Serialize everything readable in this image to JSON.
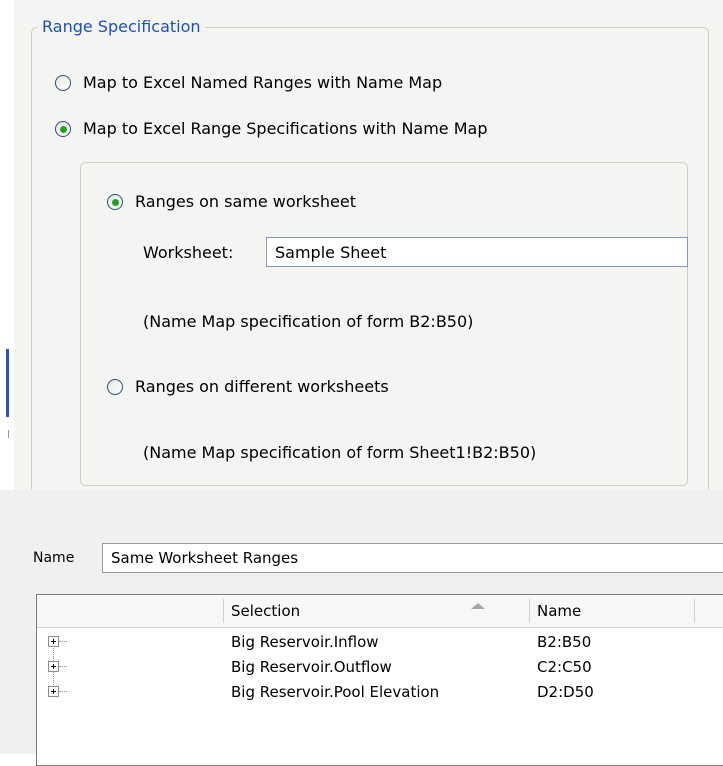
{
  "range_specification": {
    "legend": "Range Specification",
    "options": [
      {
        "label": "Map to Excel Named Ranges with Name Map",
        "selected": false
      },
      {
        "label": "Map to Excel Range Specifications with Name Map",
        "selected": true
      }
    ],
    "sub_options": {
      "same_worksheet": {
        "label": "Ranges on same worksheet",
        "selected": true,
        "worksheet_label": "Worksheet:",
        "worksheet_value": "Sample Sheet",
        "hint": "(Name Map specification of form B2:B50)"
      },
      "different_worksheets": {
        "label": "Ranges on different worksheets",
        "selected": false,
        "hint": "(Name Map specification of form Sheet1!B2:B50)"
      }
    }
  },
  "name_section": {
    "label": "Name",
    "value": "Same Worksheet Ranges"
  },
  "table": {
    "columns": [
      "Selection",
      "Name"
    ],
    "sort_column": "Selection",
    "rows": [
      {
        "selection": "Big Reservoir.Inflow",
        "name": "B2:B50"
      },
      {
        "selection": "Big Reservoir.Outflow",
        "name": "C2:C50"
      },
      {
        "selection": "Big Reservoir.Pool Elevation",
        "name": "D2:D50"
      }
    ]
  },
  "icons": {
    "expander": "plus-box-icon",
    "sort": "sort-ascending-icon"
  },
  "colors": {
    "legend_text": "#1d4fbf",
    "radio_selected_dot": "#21a121",
    "panel_background": "#f4f4f2"
  }
}
